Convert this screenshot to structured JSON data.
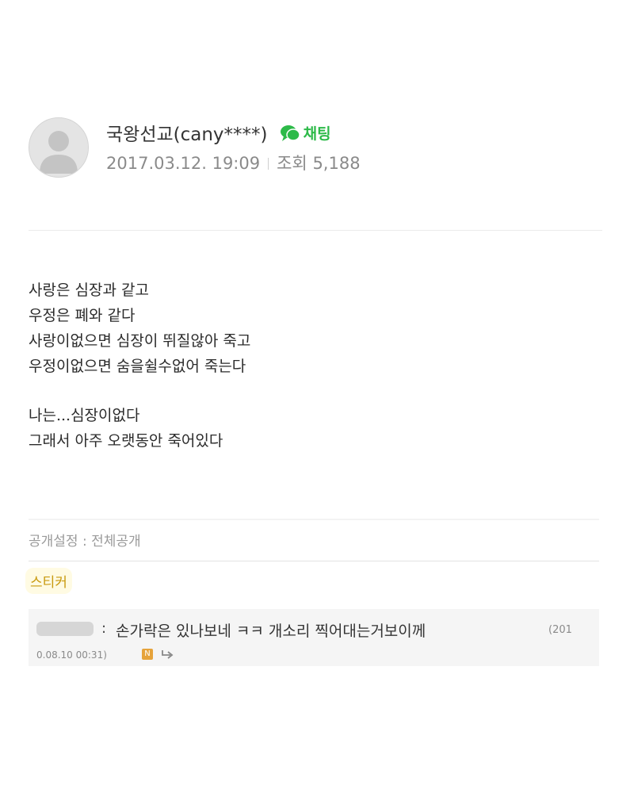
{
  "post": {
    "author": "국왕선교(cany****)",
    "chat_label": "채팅",
    "date": "2017.03.12. 19:09",
    "views_label": "조회",
    "views": "5,188",
    "lines": [
      "사랑은 심장과 같고",
      "우정은 폐와 같다",
      "사랑이없으면 심장이 뛰질않아 죽고",
      "우정이없으면 숨을쉴수없어 죽는다",
      "나는...심장이없다",
      "그래서 아주 오랫동안 죽어있다"
    ]
  },
  "footer": {
    "visibility": "공개설정 : 전체공개",
    "sticker_label": "스티커"
  },
  "comment": {
    "username": "",
    "colon": ":",
    "text": "손가락은 있나보네 ㅋㅋ 개소리 찍어대는거보이께",
    "date_part1": "(201",
    "date_part2": "0.08.10 00:31)",
    "badge": "N"
  },
  "colors": {
    "chat_green": "#2dba49",
    "sticker_gold": "#c99a10",
    "comment_bg": "#f5f5f5"
  },
  "icons": [
    "default-avatar-icon",
    "chat-bubble-icon",
    "reply-arrow-icon"
  ]
}
